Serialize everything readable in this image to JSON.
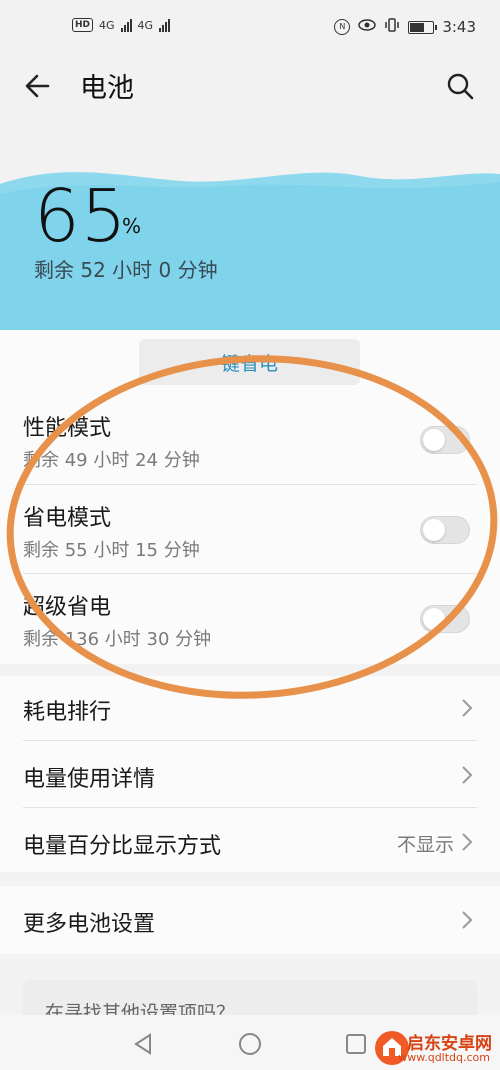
{
  "status_bar": {
    "signal_label": "4G",
    "time": "3:43"
  },
  "header": {
    "title": "电池"
  },
  "battery": {
    "percent": "65",
    "percent_sign": "%",
    "remaining": "剩余 52 小时 0 分钟",
    "level_fraction": 0.65
  },
  "one_key_button": "键省电",
  "modes": [
    {
      "title": "性能模式",
      "subtitle": "剩余 49 小时 24 分钟",
      "enabled": false
    },
    {
      "title": "省电模式",
      "subtitle": "剩余 55 小时 15 分钟",
      "enabled": false
    },
    {
      "title": "超级省电",
      "subtitle": "剩余 136 小时 30 分钟",
      "enabled": false
    }
  ],
  "menu": [
    {
      "label": "耗电排行"
    },
    {
      "label": "电量使用详情"
    },
    {
      "label": "电量百分比显示方式",
      "value": "不显示"
    }
  ],
  "more": {
    "label": "更多电池设置"
  },
  "hint": {
    "text": "在寻找其他设置项吗？"
  },
  "watermark": {
    "line1": "启东安卓网",
    "line2": "www.qdltdq.com"
  },
  "colors": {
    "wave": "#7fd3ea",
    "accent": "#2a8fc0",
    "annotation": "#e8914a"
  }
}
